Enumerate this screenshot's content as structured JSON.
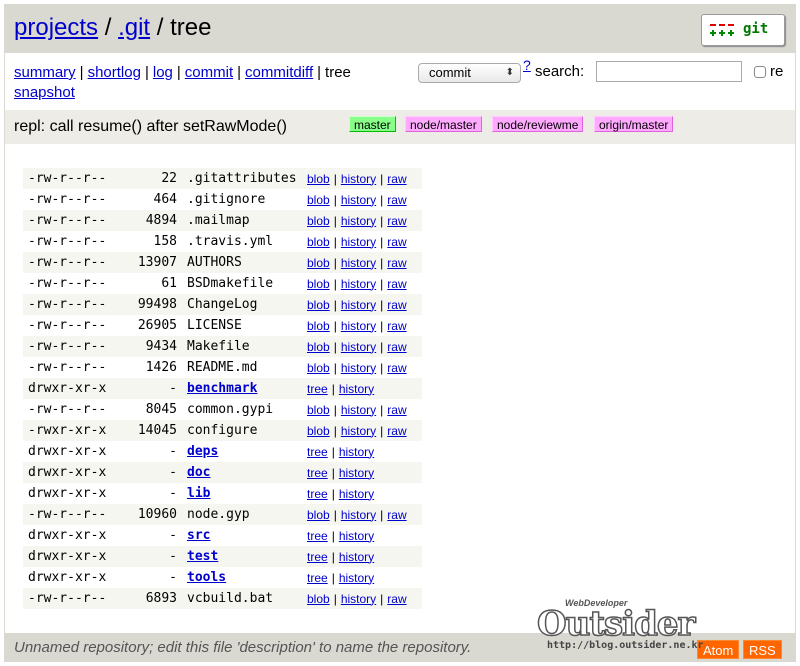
{
  "header": {
    "projects": "projects",
    "sep1": "/",
    "repo": ".git",
    "sep2": "/",
    "current": "tree",
    "logo_text": "git"
  },
  "nav": {
    "summary": "summary",
    "shortlog": "shortlog",
    "log": "log",
    "commit": "commit",
    "commitdiff": "commitdiff",
    "tree": "tree",
    "snapshot": "snapshot",
    "separator": "|"
  },
  "search": {
    "select_value": "commit",
    "help": "?",
    "label": "search:",
    "value": "",
    "regex_label": "re"
  },
  "title": {
    "message": "repl: call resume() after setRawMode()",
    "refs": [
      {
        "name": "master",
        "kind": "head"
      },
      {
        "name": "node/master",
        "kind": "remote"
      },
      {
        "name": "node/reviewme",
        "kind": "remote"
      },
      {
        "name": "origin/master",
        "kind": "remote"
      }
    ]
  },
  "files": [
    {
      "mode": "-rw-r--r--",
      "size": "22",
      "name": ".gitattributes",
      "type": "blob"
    },
    {
      "mode": "-rw-r--r--",
      "size": "464",
      "name": ".gitignore",
      "type": "blob"
    },
    {
      "mode": "-rw-r--r--",
      "size": "4894",
      "name": ".mailmap",
      "type": "blob"
    },
    {
      "mode": "-rw-r--r--",
      "size": "158",
      "name": ".travis.yml",
      "type": "blob"
    },
    {
      "mode": "-rw-r--r--",
      "size": "13907",
      "name": "AUTHORS",
      "type": "blob"
    },
    {
      "mode": "-rw-r--r--",
      "size": "61",
      "name": "BSDmakefile",
      "type": "blob"
    },
    {
      "mode": "-rw-r--r--",
      "size": "99498",
      "name": "ChangeLog",
      "type": "blob"
    },
    {
      "mode": "-rw-r--r--",
      "size": "26905",
      "name": "LICENSE",
      "type": "blob"
    },
    {
      "mode": "-rw-r--r--",
      "size": "9434",
      "name": "Makefile",
      "type": "blob"
    },
    {
      "mode": "-rw-r--r--",
      "size": "1426",
      "name": "README.md",
      "type": "blob"
    },
    {
      "mode": "drwxr-xr-x",
      "size": "-",
      "name": "benchmark",
      "type": "tree"
    },
    {
      "mode": "-rw-r--r--",
      "size": "8045",
      "name": "common.gypi",
      "type": "blob"
    },
    {
      "mode": "-rwxr-xr-x",
      "size": "14045",
      "name": "configure",
      "type": "blob"
    },
    {
      "mode": "drwxr-xr-x",
      "size": "-",
      "name": "deps",
      "type": "tree"
    },
    {
      "mode": "drwxr-xr-x",
      "size": "-",
      "name": "doc",
      "type": "tree"
    },
    {
      "mode": "drwxr-xr-x",
      "size": "-",
      "name": "lib",
      "type": "tree"
    },
    {
      "mode": "-rw-r--r--",
      "size": "10960",
      "name": "node.gyp",
      "type": "blob"
    },
    {
      "mode": "drwxr-xr-x",
      "size": "-",
      "name": "src",
      "type": "tree"
    },
    {
      "mode": "drwxr-xr-x",
      "size": "-",
      "name": "test",
      "type": "tree"
    },
    {
      "mode": "drwxr-xr-x",
      "size": "-",
      "name": "tools",
      "type": "tree"
    },
    {
      "mode": "-rw-r--r--",
      "size": "6893",
      "name": "vcbuild.bat",
      "type": "blob"
    }
  ],
  "link_labels": {
    "blob": "blob",
    "tree": "tree",
    "history": "history",
    "raw": "raw",
    "sep": "|"
  },
  "footer": {
    "description": "Unnamed repository; edit this file 'description' to name the repository.",
    "atom": "Atom",
    "rss": "RSS"
  },
  "watermark": {
    "small": "WebDeveloper",
    "big": "Outsider",
    "url": "http://blog.outsider.ne.kr"
  },
  "colors": {
    "header_bg": "#d9d8d1",
    "link": "#0000cc",
    "head_ref": "#88ff88",
    "remote_ref": "#ffaaff",
    "feed": "#ff6600"
  }
}
